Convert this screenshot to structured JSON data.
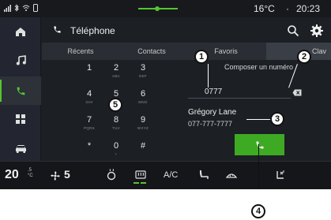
{
  "status_bar": {
    "temperature": "16°C",
    "separator": "·",
    "time": "20:23",
    "accent_color": "#55c531"
  },
  "nav": {
    "items": [
      {
        "name": "home",
        "icon": "home-icon"
      },
      {
        "name": "music",
        "icon": "music-icon"
      },
      {
        "name": "phone",
        "icon": "phone-icon",
        "active": true
      },
      {
        "name": "apps",
        "icon": "apps-grid-icon"
      },
      {
        "name": "vehicle",
        "icon": "car-icon"
      }
    ]
  },
  "header": {
    "title": "Téléphone",
    "icons": [
      "search-icon",
      "gear-icon"
    ]
  },
  "tabs": [
    {
      "label": "Récents"
    },
    {
      "label": "Contacts"
    },
    {
      "label": "Favoris"
    },
    {
      "label": "Clav"
    }
  ],
  "keypad": {
    "keys": [
      {
        "digit": "1",
        "letters": ""
      },
      {
        "digit": "2",
        "letters": "ABC"
      },
      {
        "digit": "3",
        "letters": "DEF"
      },
      {
        "digit": "4",
        "letters": "GHI"
      },
      {
        "digit": "5",
        "letters": "JKL"
      },
      {
        "digit": "6",
        "letters": "MNO"
      },
      {
        "digit": "7",
        "letters": "PQRS"
      },
      {
        "digit": "8",
        "letters": "TUV"
      },
      {
        "digit": "9",
        "letters": "WXYZ"
      },
      {
        "digit": "*",
        "letters": ""
      },
      {
        "digit": "0",
        "letters": "+"
      },
      {
        "digit": "#",
        "letters": ""
      }
    ]
  },
  "dial": {
    "label": "Composer un numéro",
    "current_number": "0777",
    "suggestion_name": "Grégory Lane",
    "suggestion_number": "077-777-7777",
    "call_button_color": "#3eaa24"
  },
  "climate": {
    "left_temp": "20",
    "left_temp_decimal": ".5",
    "left_unit": "°C",
    "fan_level": "5",
    "ac_label": "A/C",
    "icons": [
      "fan-icon",
      "seat-heat-icon",
      "rear-defrost-icon",
      "recirculation-icon",
      "seat-icon",
      "front-defrost-icon",
      "seat-ventilation-icon"
    ]
  },
  "callouts": [
    "1",
    "2",
    "3",
    "4",
    "5"
  ]
}
